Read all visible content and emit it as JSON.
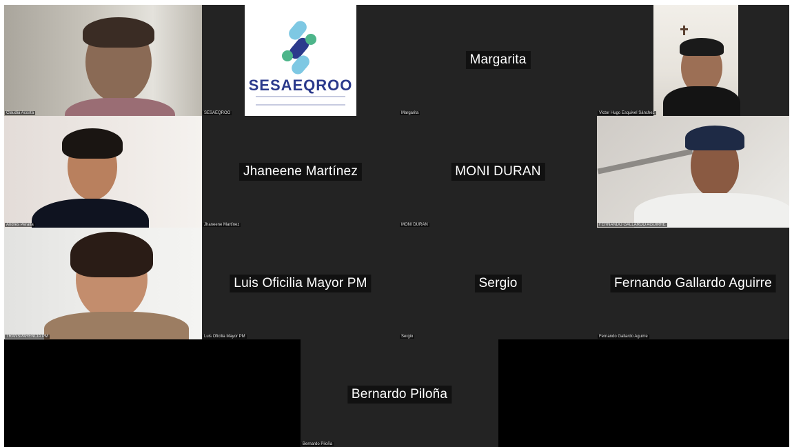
{
  "participants": [
    {
      "name": "Claudia Acosta",
      "has_video": true
    },
    {
      "name": "SESAEQROO",
      "has_video": true
    },
    {
      "name": "Margarita",
      "has_video": false
    },
    {
      "name": "Victor Hugo Esquivel Sánchez",
      "has_video": true
    },
    {
      "name": "Andres Peralta",
      "has_video": true
    },
    {
      "name": "Jhaneene Martínez",
      "has_video": false
    },
    {
      "name": "MONI DURAN",
      "has_video": false
    },
    {
      "name": "FERNANDO GALLARDO AGUIRRE",
      "has_video": true
    },
    {
      "name": "TRANSPARENCIA PM",
      "has_video": true
    },
    {
      "name": "Luis Oficilia Mayor  PM",
      "has_video": false
    },
    {
      "name": "Sergio",
      "has_video": false
    },
    {
      "name": "Fernando Gallardo Aguirre",
      "has_video": false
    },
    {
      "name": "Bernardo Piloña",
      "has_video": false
    }
  ],
  "logo": {
    "text": "SESAEQROO",
    "colors": {
      "navy": "#2b3a8c",
      "teal": "#3db7a0",
      "light_blue": "#7ec8e3",
      "green": "#4db58a"
    }
  },
  "colors": {
    "tile_bg": "#232323",
    "grid_bg": "#000000",
    "label_text": "#ffffff"
  }
}
